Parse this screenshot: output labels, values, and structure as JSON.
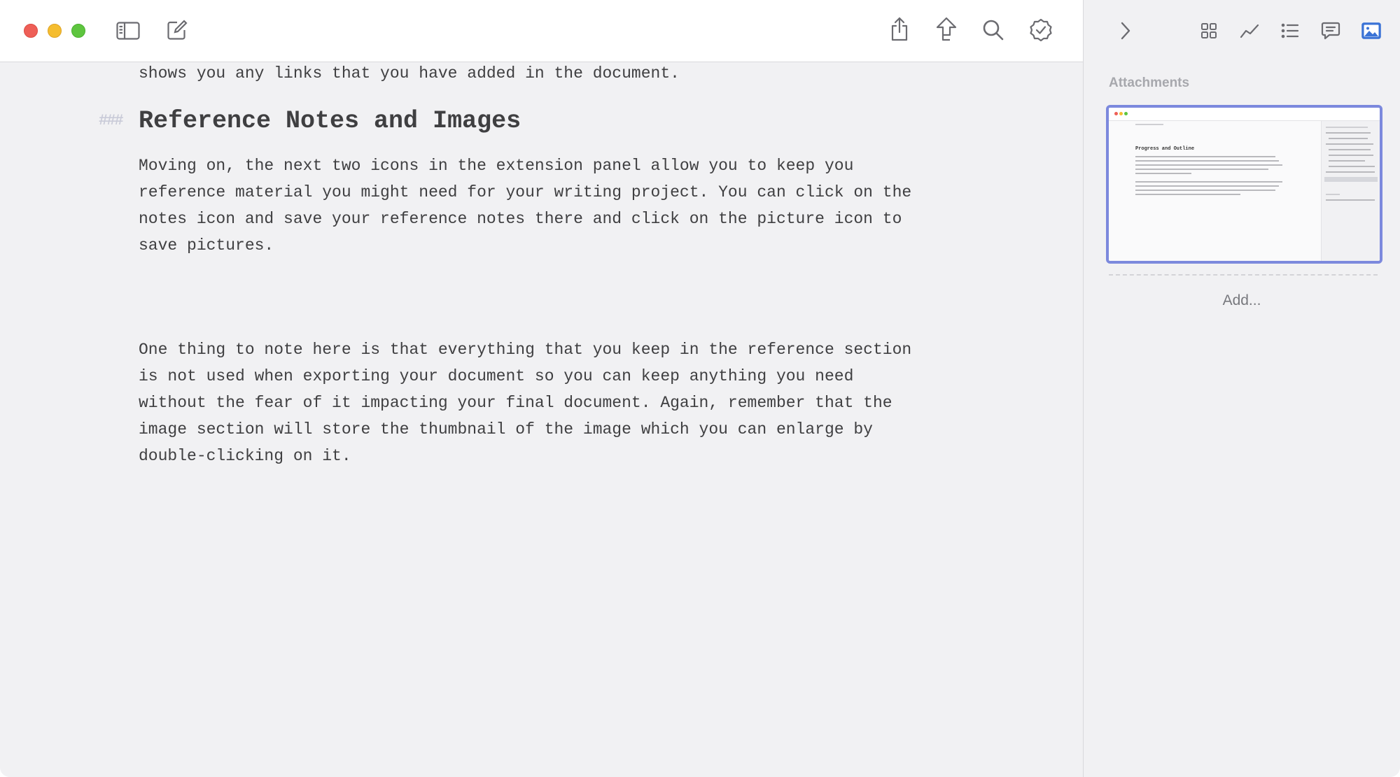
{
  "window": {
    "traffic_lights": [
      "close",
      "minimize",
      "zoom"
    ],
    "colors": {
      "close": "#ee5f57",
      "minimize": "#f5bd2f",
      "zoom": "#5ec53f",
      "accent": "#7c89dd"
    }
  },
  "toolbar": {
    "left_icons": [
      "sidebar-toggle-icon",
      "compose-icon"
    ],
    "right_icons": [
      "share-icon",
      "publish-icon",
      "search-icon",
      "check-badge-icon"
    ]
  },
  "editor": {
    "partial_line": "shows you any links that you have added in the document.",
    "heading_marker": "###",
    "heading": "Reference Notes and Images",
    "paragraph1": {
      "lines": [
        "Moving on, the next two icons in the extension panel allow you to keep you",
        "reference material you might need for your writing project. You can click on the",
        "notes icon and save your reference notes there and click on the picture icon to",
        "save pictures."
      ]
    },
    "paragraph2": {
      "lines": [
        "One thing to note here is that everything that you keep in the reference section",
        "is not used when exporting your document so you can keep anything you need",
        "without the fear of it impacting your final document. Again, remember that the",
        "image section will store the thumbnail of the image which you can enlarge by",
        "double-clicking on it."
      ]
    }
  },
  "panel": {
    "icons": [
      "chevron-right-icon",
      "grid-icon",
      "stats-icon",
      "list-icon",
      "notes-icon",
      "image-icon"
    ],
    "active_icon": "image-icon",
    "title": "Attachments",
    "add_label": "Add...",
    "thumbnail": {
      "heading": "Progress and Outline"
    }
  }
}
